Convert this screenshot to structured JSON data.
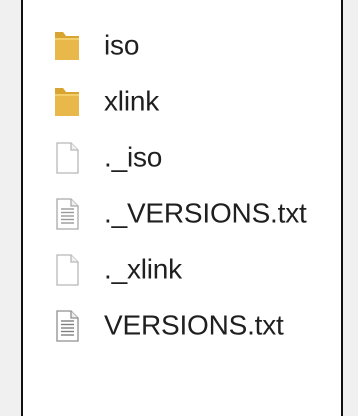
{
  "files": [
    {
      "name": "iso",
      "icon": "folder-icon"
    },
    {
      "name": "xlink",
      "icon": "folder-icon"
    },
    {
      "name": "._iso",
      "icon": "blank-file-icon"
    },
    {
      "name": "._VERSIONS.txt",
      "icon": "text-file-icon"
    },
    {
      "name": "._xlink",
      "icon": "blank-file-icon"
    },
    {
      "name": "VERSIONS.txt",
      "icon": "text-file-icon"
    }
  ],
  "colors": {
    "folder": "#e8b84a",
    "folder_dark": "#d9a431",
    "file_border": "#b8b8b8",
    "text": "#1f1f1f"
  }
}
